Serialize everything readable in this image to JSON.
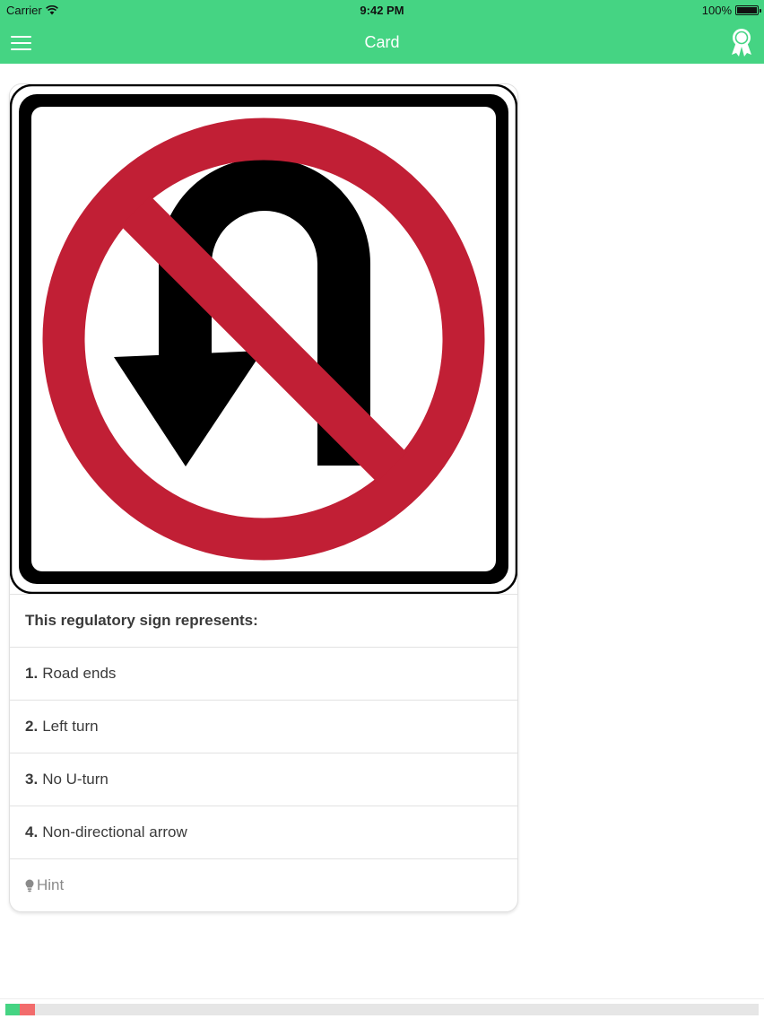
{
  "status_bar": {
    "carrier": "Carrier",
    "time": "9:42 PM",
    "battery": "100%"
  },
  "nav": {
    "title": "Card",
    "menu_icon": "hamburger-menu-icon",
    "right_icon": "award-ribbon-icon"
  },
  "card": {
    "image": "no-u-turn-sign",
    "question": "This regulatory sign represents:",
    "options": [
      {
        "number": "1.",
        "text": "Road ends"
      },
      {
        "number": "2.",
        "text": "Left turn"
      },
      {
        "number": "3.",
        "text": "No U-turn"
      },
      {
        "number": "4.",
        "text": "Non-directional arrow"
      }
    ],
    "hint_label": "Hint",
    "hint_icon": "lightbulb-icon"
  },
  "progress": {
    "correct_fraction": 0.019,
    "wrong_fraction": 0.02
  },
  "colors": {
    "accent": "#45d483",
    "sign_red": "#c11f35",
    "wrong": "#f26c6c"
  }
}
